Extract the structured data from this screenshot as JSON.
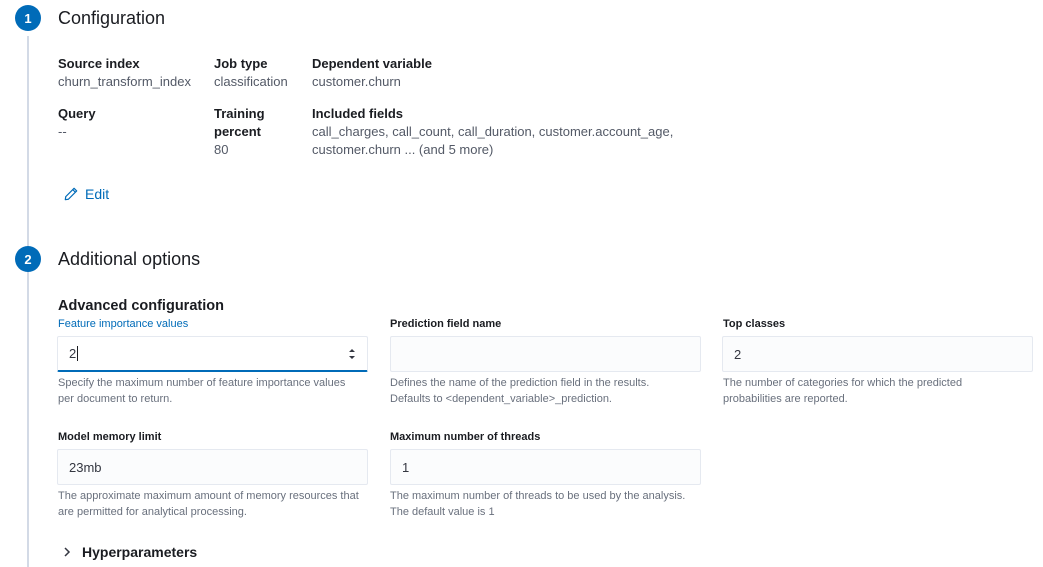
{
  "steps": {
    "configuration": {
      "number": "1",
      "title": "Configuration"
    },
    "additional": {
      "number": "2",
      "title": "Additional options"
    }
  },
  "summary": {
    "source_index": {
      "title": "Source index",
      "value": "churn_transform_index"
    },
    "job_type": {
      "title": "Job type",
      "value": "classification"
    },
    "dependent_variable": {
      "title": "Dependent variable",
      "value": "customer.churn"
    },
    "query": {
      "title": "Query",
      "value": "--"
    },
    "training_percent": {
      "title_line1": "Training",
      "title_line2": "percent",
      "value": "80"
    },
    "included_fields": {
      "title": "Included fields",
      "line1": "call_charges, call_count, call_duration, customer.account_age,",
      "line2": "customer.churn ... (and 5 more)"
    }
  },
  "edit": {
    "label": "Edit"
  },
  "advanced": {
    "title": "Advanced configuration",
    "feature_importance": {
      "label": "Feature importance values",
      "value": "2",
      "help_line1": "Specify the maximum number of feature importance values",
      "help_line2": "per document to return."
    },
    "prediction_field": {
      "label": "Prediction field name",
      "value": "",
      "help_line1": "Defines the name of the prediction field in the results.",
      "help_line2": "Defaults to <dependent_variable>_prediction."
    },
    "top_classes": {
      "label": "Top classes",
      "value": "2",
      "help_line1": "The number of categories for which the predicted",
      "help_line2": "probabilities are reported."
    },
    "model_memory": {
      "label": "Model memory limit",
      "value": "23mb",
      "help_line1": "The approximate maximum amount of memory resources that",
      "help_line2": "are permitted for analytical processing."
    },
    "max_threads": {
      "label": "Maximum number of threads",
      "value": "1",
      "help_line1": "The maximum number of threads to be used by the analysis.",
      "help_line2": "The default value is 1"
    }
  },
  "hyperparameters": {
    "label": "Hyperparameters"
  },
  "colors": {
    "accent": "#006bb8",
    "step_line": "#d3dae6"
  }
}
